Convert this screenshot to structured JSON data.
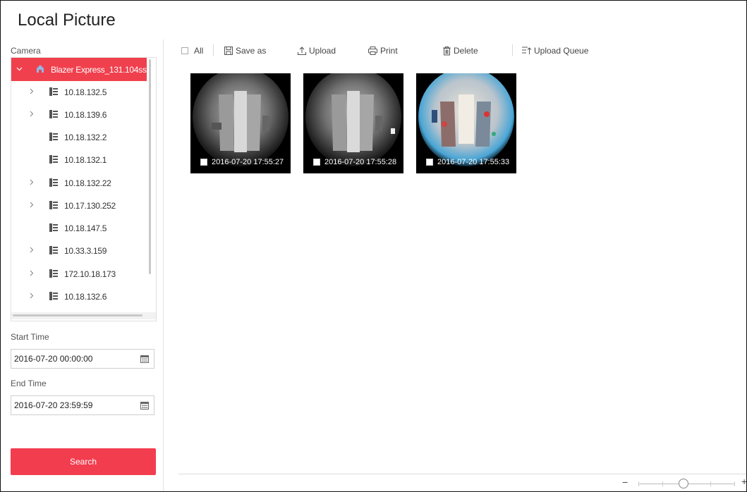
{
  "page": {
    "title": "Local Picture"
  },
  "sidebar": {
    "camera_label": "Camera",
    "tree": [
      {
        "label": "Blazer Express_131.104ss",
        "icon": "home-icon",
        "expanded": true,
        "selected": true
      },
      {
        "label": "10.18.132.5",
        "icon": "device-icon",
        "has_children": true
      },
      {
        "label": "10.18.139.6",
        "icon": "device-icon",
        "has_children": true
      },
      {
        "label": "10.18.132.2",
        "icon": "device-icon",
        "has_children": false
      },
      {
        "label": "10.18.132.1",
        "icon": "device-icon",
        "has_children": false
      },
      {
        "label": "10.18.132.22",
        "icon": "device-icon",
        "has_children": true
      },
      {
        "label": "10.17.130.252",
        "icon": "device-icon",
        "has_children": true
      },
      {
        "label": "10.18.147.5",
        "icon": "device-icon",
        "has_children": false
      },
      {
        "label": "10.33.3.159",
        "icon": "device-icon",
        "has_children": true
      },
      {
        "label": "172.10.18.173",
        "icon": "device-icon",
        "has_children": true
      },
      {
        "label": "10.18.132.6",
        "icon": "device-icon",
        "has_children": true
      }
    ],
    "start_time_label": "Start Time",
    "start_time_value": "2016-07-20 00:00:00",
    "end_time_label": "End Time",
    "end_time_value": "2016-07-20 23:59:59",
    "search_label": "Search"
  },
  "toolbar": {
    "all_label": "All",
    "save_as_label": "Save as",
    "upload_label": "Upload",
    "print_label": "Print",
    "delete_label": "Delete",
    "upload_queue_label": "Upload Queue"
  },
  "pictures": [
    {
      "timestamp": "2016-07-20 17:55:27",
      "style": "grayscale-fisheye"
    },
    {
      "timestamp": "2016-07-20 17:55:28",
      "style": "grayscale-fisheye"
    },
    {
      "timestamp": "2016-07-20 17:55:33",
      "style": "color-fisheye"
    }
  ],
  "zoom": {
    "minus_label": "−",
    "plus_label": "+",
    "level": 0.47
  },
  "colors": {
    "accent": "#f23d4f",
    "selected_row": "#f0404d"
  }
}
